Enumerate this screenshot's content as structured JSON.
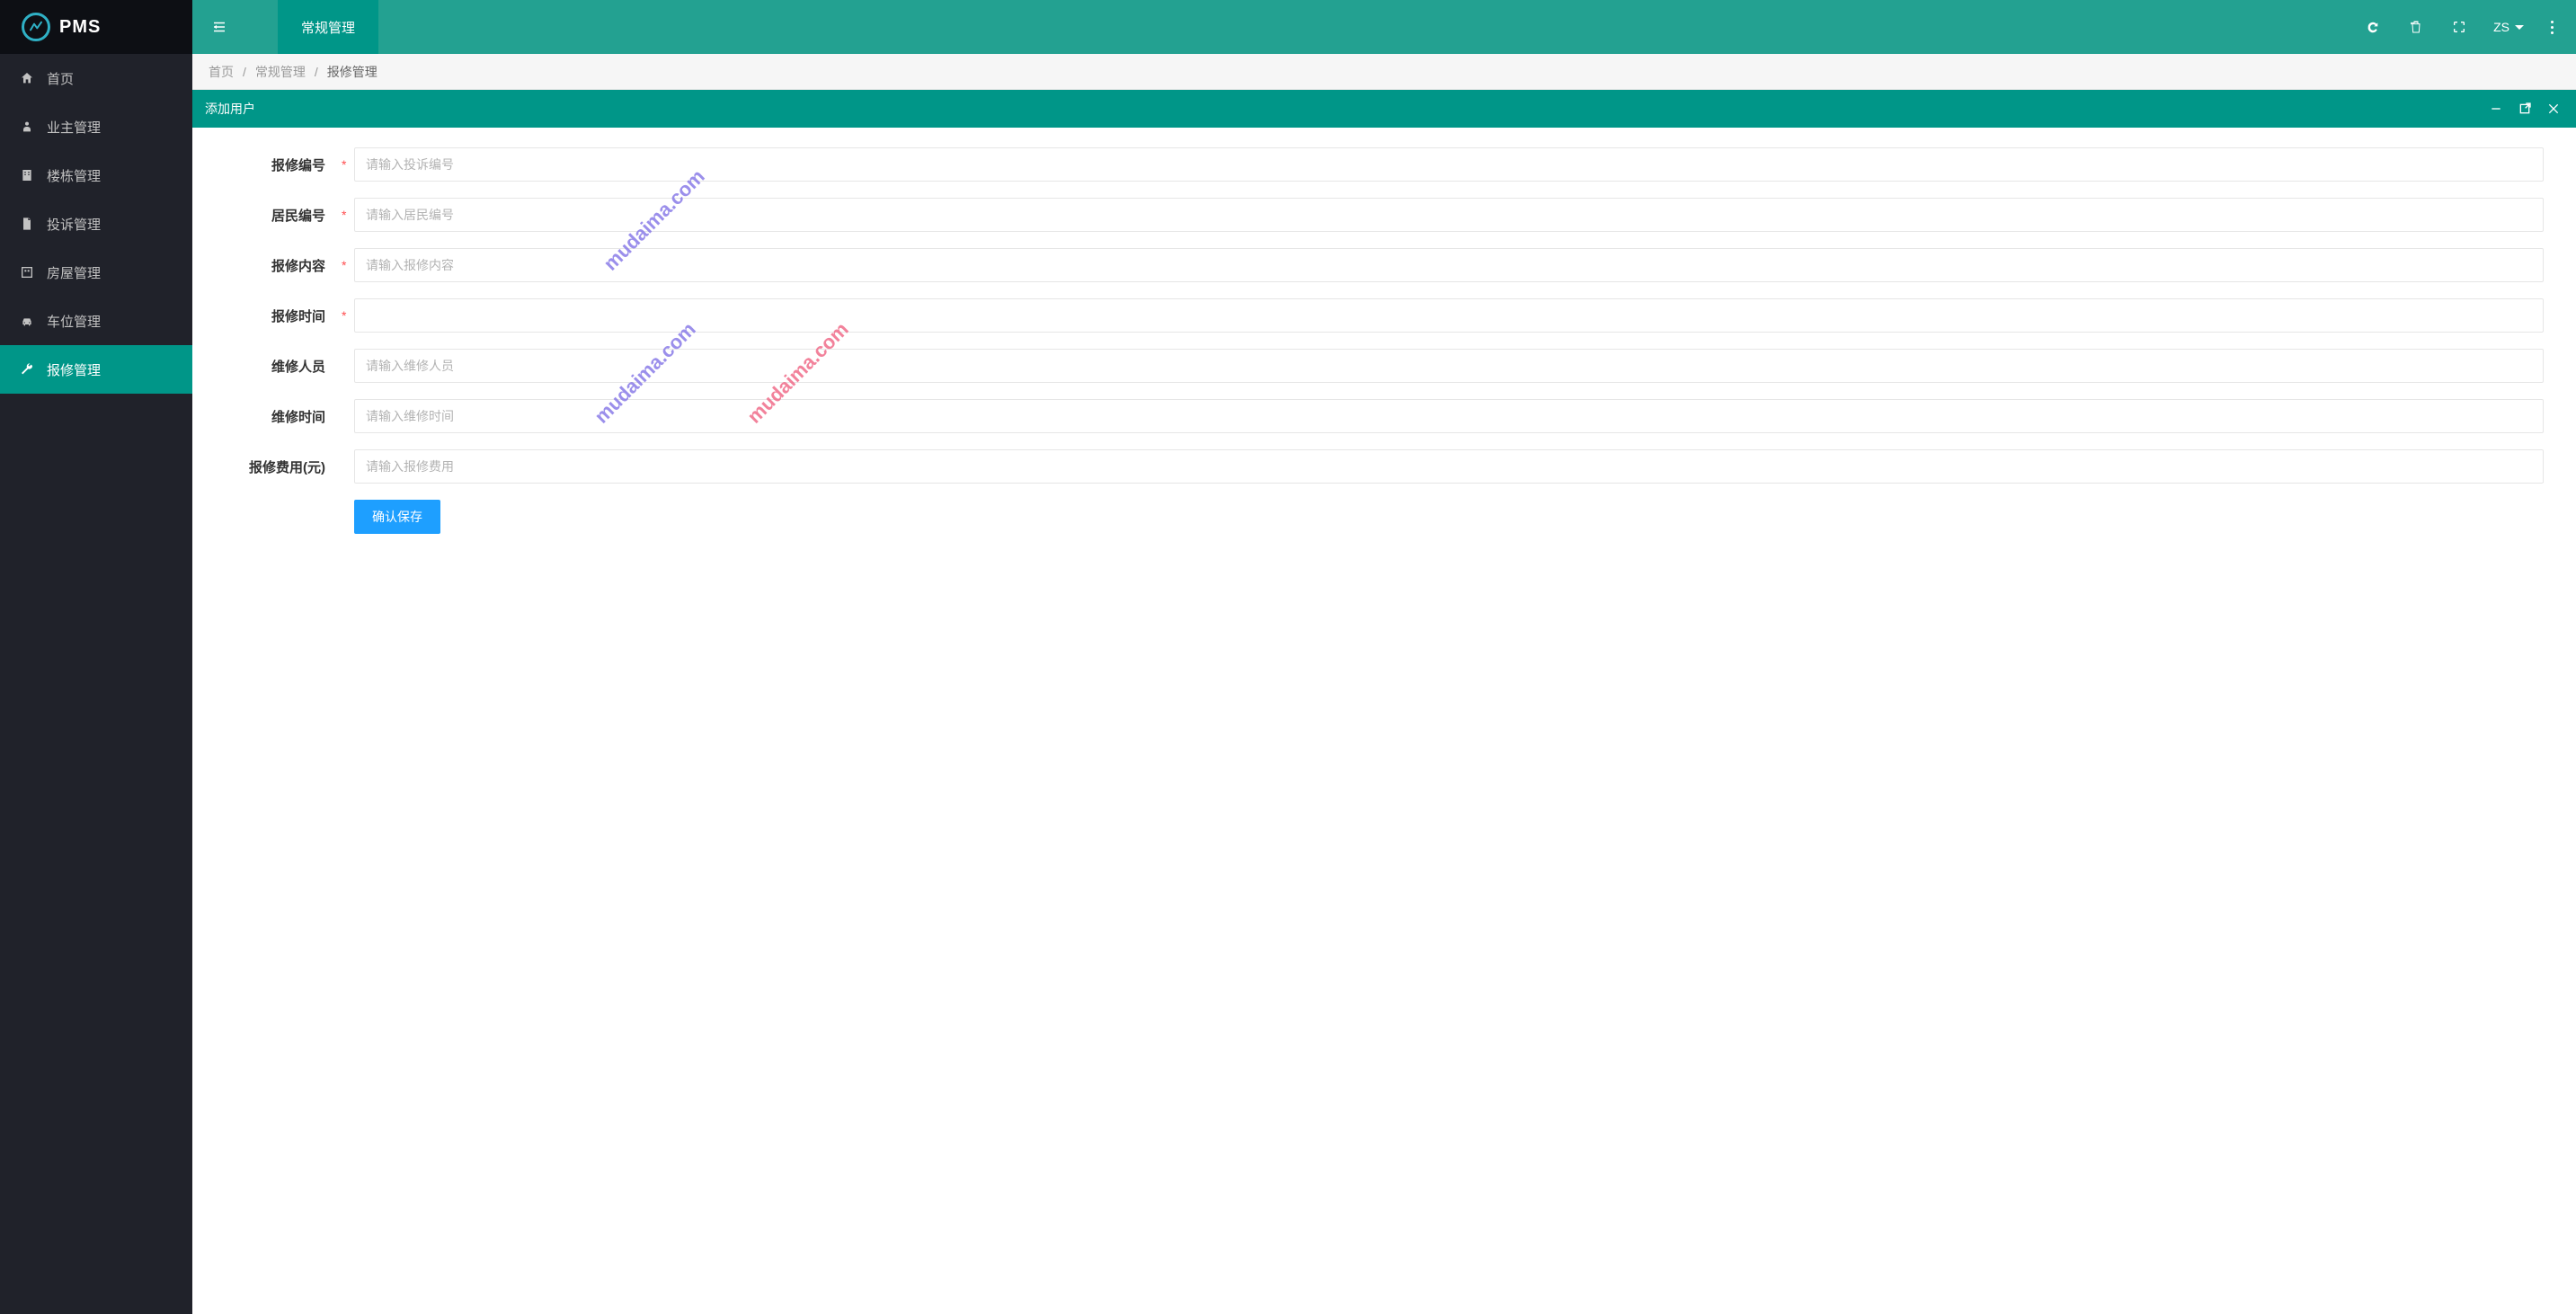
{
  "brand": "PMS",
  "sidebar": {
    "items": [
      {
        "label": "首页",
        "icon": "home"
      },
      {
        "label": "业主管理",
        "icon": "user"
      },
      {
        "label": "楼栋管理",
        "icon": "building"
      },
      {
        "label": "投诉管理",
        "icon": "file"
      },
      {
        "label": "房屋管理",
        "icon": "room"
      },
      {
        "label": "车位管理",
        "icon": "car"
      },
      {
        "label": "报修管理",
        "icon": "wrench",
        "active": true
      }
    ]
  },
  "topbar": {
    "tab": "常规管理",
    "user": "ZS"
  },
  "breadcrumb": {
    "home": "首页",
    "section": "常规管理",
    "current": "报修管理"
  },
  "panel": {
    "title": "添加用户"
  },
  "form": {
    "fields": [
      {
        "label": "报修编号",
        "required": true,
        "placeholder": "请输入投诉编号"
      },
      {
        "label": "居民编号",
        "required": true,
        "placeholder": "请输入居民编号"
      },
      {
        "label": "报修内容",
        "required": true,
        "placeholder": "请输入报修内容"
      },
      {
        "label": "报修时间",
        "required": true,
        "placeholder": ""
      },
      {
        "label": "维修人员",
        "required": false,
        "placeholder": "请输入维修人员"
      },
      {
        "label": "维修时间",
        "required": false,
        "placeholder": "请输入维修时间"
      },
      {
        "label": "报修费用(元)",
        "required": false,
        "placeholder": "请输入报修费用"
      }
    ],
    "submit": "确认保存"
  },
  "watermark": "mudaima.com"
}
